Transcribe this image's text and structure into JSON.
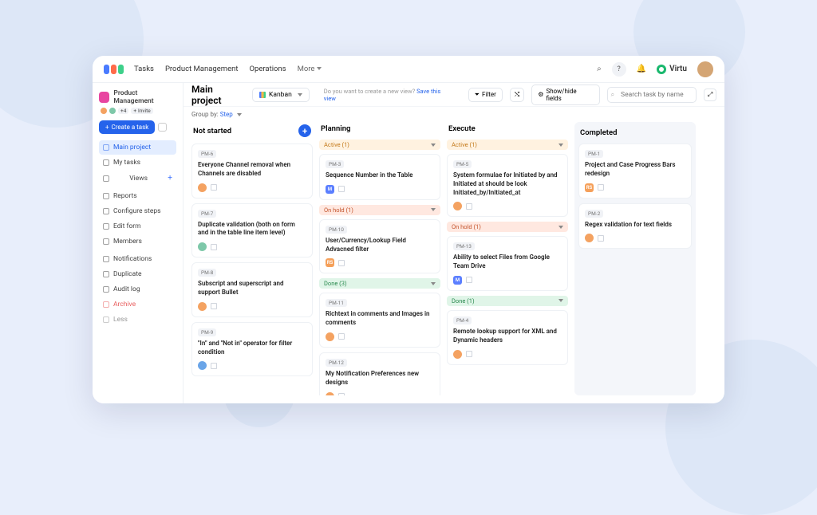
{
  "topnav": {
    "tasks": "Tasks",
    "pm": "Product Management",
    "ops": "Operations",
    "more": "More"
  },
  "brand": "Virtu",
  "project": {
    "name": "Product Management",
    "members_count": "+4",
    "invite": "Invite"
  },
  "sidebar": {
    "create": "Create a task",
    "items": [
      {
        "label": "Main project",
        "active": true
      },
      {
        "label": "My tasks"
      },
      {
        "label": "Views",
        "views": true
      },
      {
        "label": "Reports",
        "section": true
      },
      {
        "label": "Configure steps"
      },
      {
        "label": "Edit form"
      },
      {
        "label": "Members"
      },
      {
        "label": "Notifications",
        "section": true
      },
      {
        "label": "Duplicate"
      },
      {
        "label": "Audit log"
      },
      {
        "label": "Archive",
        "red": true
      },
      {
        "label": "Less",
        "mute": true
      }
    ]
  },
  "header": {
    "title": "Main project",
    "view": "Kanban",
    "hint_q": "Do you want to create a new view?",
    "hint_a": "Save this view",
    "filter": "Filter",
    "showhide": "Show/hide fields",
    "search_ph": "Search task by name"
  },
  "groupby": {
    "label": "Group by:",
    "value": "Step"
  },
  "columns": [
    {
      "name": "Not started",
      "add": true,
      "groups": [
        {
          "cards": [
            {
              "id": "PM-6",
              "title": "Everyone Channel removal when Channels are disabled",
              "av": "o"
            },
            {
              "id": "PM-7",
              "title": "Duplicate validation (both on form and in the table line item level)",
              "av": "g"
            },
            {
              "id": "PM-8",
              "title": "Subscript and superscript and support Bullet",
              "av": "o"
            },
            {
              "id": "PM-9",
              "title": "\"In\" and \"Not in\" operator for filter condition",
              "av": "b"
            }
          ]
        }
      ]
    },
    {
      "name": "Planning",
      "groups": [
        {
          "status": "Active (1)",
          "tone": "orange",
          "cards": [
            {
              "id": "PM-3",
              "title": "Sequence Number in the Table",
              "sq": "M",
              "sqc": "#5b7fff"
            }
          ]
        },
        {
          "status": "On hold (1)",
          "tone": "hold",
          "cards": [
            {
              "id": "PM-10",
              "title": "User/Currency/Lookup Field Advacned filter",
              "sq": "RS",
              "sqc": "#f5a05a"
            }
          ]
        },
        {
          "status": "Done (3)",
          "tone": "done",
          "cards": [
            {
              "id": "PM-11",
              "title": "Richtext in comments and Images in comments",
              "av": "o"
            },
            {
              "id": "PM-12",
              "title": "My Notification Preferences new designs",
              "av": "o"
            }
          ]
        }
      ]
    },
    {
      "name": "Execute",
      "groups": [
        {
          "status": "Active (1)",
          "tone": "orange",
          "cards": [
            {
              "id": "PM-5",
              "title": "System formulae for Initiated by and Initiated at should be look Initiated_by/Initiated_at",
              "av": "o"
            }
          ]
        },
        {
          "status": "On hold (1)",
          "tone": "hold",
          "cards": [
            {
              "id": "PM-13",
              "title": "Ability to select Files from Google Team Drive",
              "sq": "M",
              "sqc": "#5b7fff"
            }
          ]
        },
        {
          "status": "Done (1)",
          "tone": "done",
          "cards": [
            {
              "id": "PM-4",
              "title": "Remote lookup support for XML and Dynamic headers",
              "av": "o"
            }
          ]
        }
      ]
    },
    {
      "name": "Completed",
      "completed": true,
      "groups": [
        {
          "cards": [
            {
              "id": "PM-1",
              "title": "Project and Case Progress Bars redesign",
              "sq": "RS",
              "sqc": "#f5a05a"
            },
            {
              "id": "PM-2",
              "title": "Regex validation for text fields",
              "av": "o"
            }
          ]
        }
      ]
    }
  ]
}
